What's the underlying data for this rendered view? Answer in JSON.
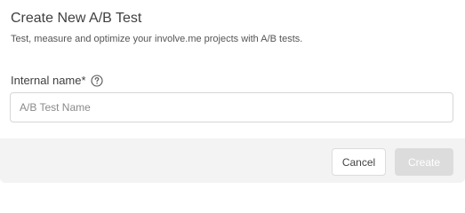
{
  "dialog": {
    "title": "Create New A/B Test",
    "subtitle": "Test, measure and optimize your involve.me projects with A/B tests."
  },
  "form": {
    "internal_name": {
      "label": "Internal name*",
      "help_icon": "question-circle-icon",
      "value": "",
      "placeholder": "A/B Test Name"
    }
  },
  "footer": {
    "cancel_label": "Cancel",
    "create_label": "Create",
    "create_disabled": true
  },
  "colors": {
    "footer_background": "#f3f3f3",
    "disabled_button": "#dcdcdc",
    "input_border": "#d6d6d6"
  }
}
